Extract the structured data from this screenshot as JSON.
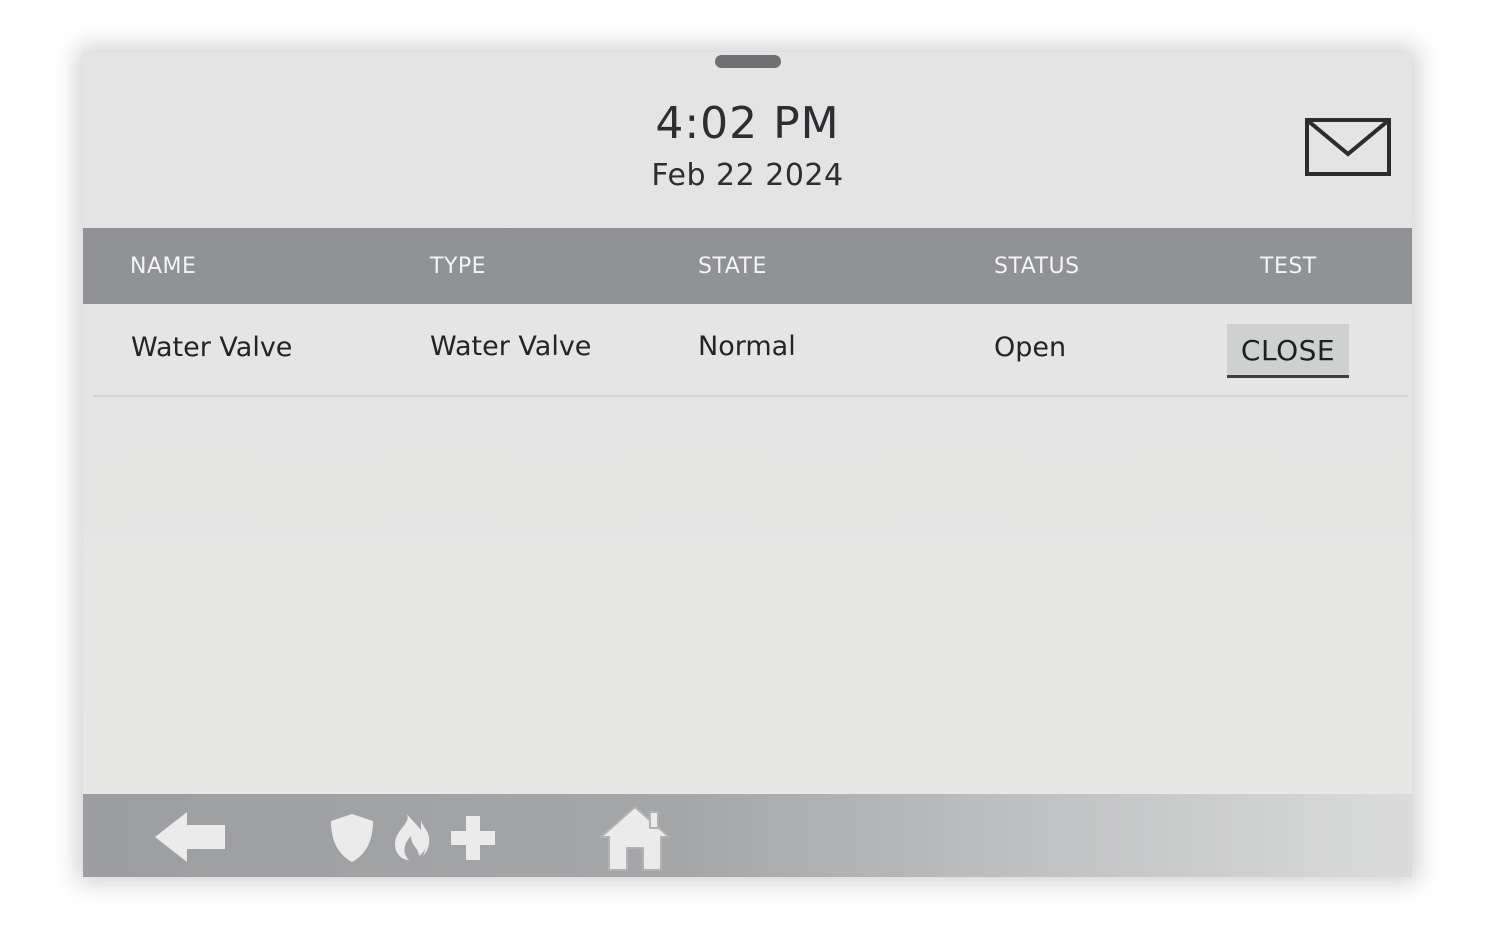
{
  "header": {
    "time": "4:02 PM",
    "date": "Feb 22 2024"
  },
  "table": {
    "columns": [
      "NAME",
      "TYPE",
      "STATE",
      "STATUS",
      "TEST"
    ],
    "rows": [
      {
        "name": "Water Valve",
        "type": "Water Valve",
        "state": "Normal",
        "status": "Open",
        "test_button": "CLOSE"
      }
    ]
  },
  "icons": {
    "mail": "envelope-icon",
    "back": "back-arrow-icon",
    "police": "shield-icon",
    "fire": "flame-icon",
    "medical": "medical-cross-icon",
    "home": "home-icon"
  },
  "colors": {
    "header_bar": "#909296",
    "screen_bg": "#e4e5e4",
    "button_bg": "#cfd0d0",
    "footer_bar": "#a4a6a8"
  }
}
